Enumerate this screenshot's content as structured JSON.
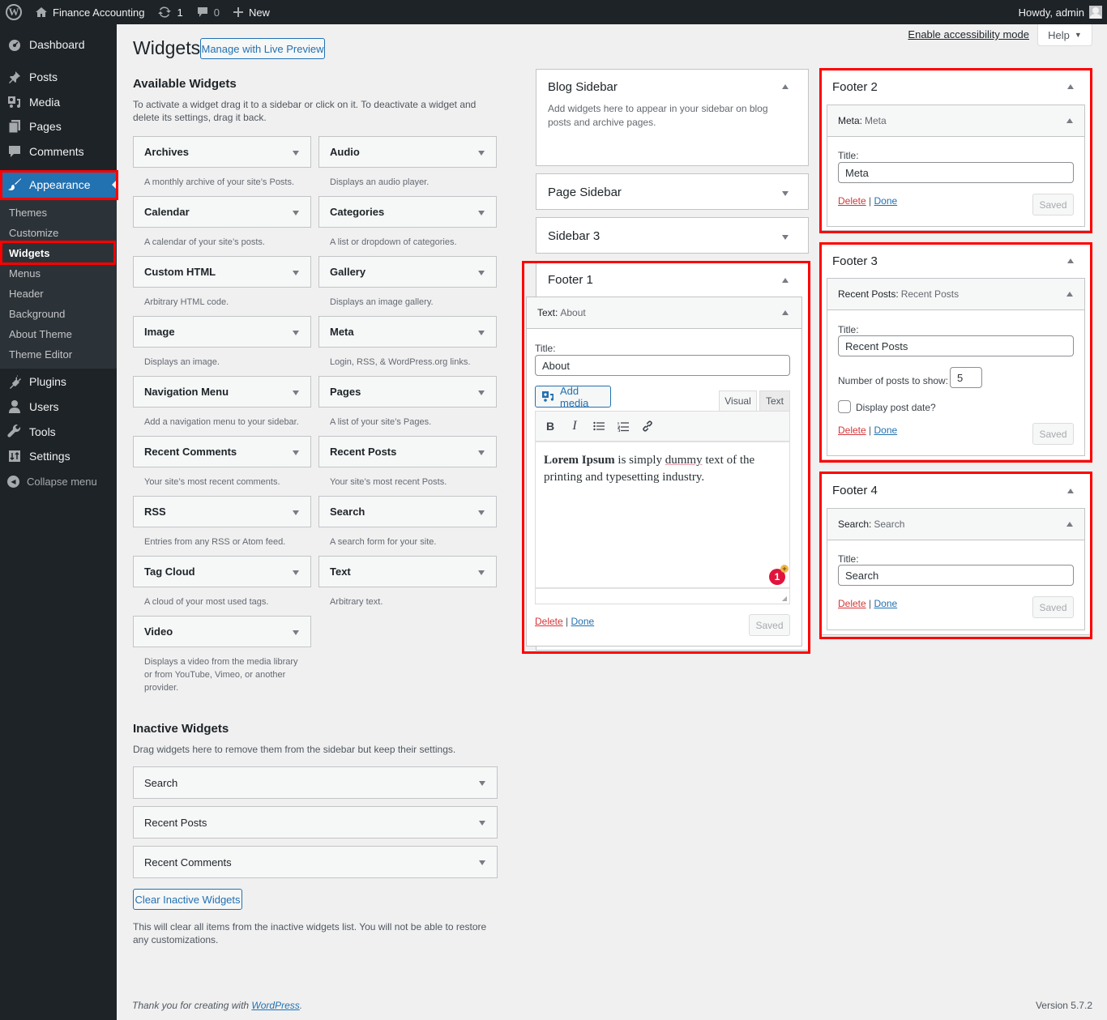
{
  "adminbar": {
    "site_name": "Finance Accounting",
    "updates_count": "1",
    "comments_count": "0",
    "new_label": "New",
    "greeting": "Howdy, admin"
  },
  "menu": {
    "items": [
      {
        "label": "Dashboard",
        "icon": "dashboard-icon"
      },
      {
        "label": "Posts",
        "icon": "pin-icon"
      },
      {
        "label": "Media",
        "icon": "media-icon"
      },
      {
        "label": "Pages",
        "icon": "pages-icon"
      },
      {
        "label": "Comments",
        "icon": "comment-icon"
      },
      {
        "label": "Appearance",
        "icon": "paintbrush-icon"
      },
      {
        "label": "Plugins",
        "icon": "plugin-icon"
      },
      {
        "label": "Users",
        "icon": "user-icon"
      },
      {
        "label": "Tools",
        "icon": "wrench-icon"
      },
      {
        "label": "Settings",
        "icon": "settings-icon"
      }
    ],
    "submenu": [
      "Themes",
      "Customize",
      "Widgets",
      "Menus",
      "Header",
      "Background",
      "About Theme",
      "Theme Editor"
    ],
    "collapse_label": "Collapse menu"
  },
  "header": {
    "title": "Widgets",
    "live_preview_label": "Manage with Live Preview",
    "accessibility_link": "Enable accessibility mode",
    "help_label": "Help"
  },
  "available": {
    "title": "Available Widgets",
    "description": "To activate a widget drag it to a sidebar or click on it. To deactivate a widget and delete its settings, drag it back.",
    "widgets": [
      {
        "name": "Archives",
        "desc": "A monthly archive of your site’s Posts."
      },
      {
        "name": "Audio",
        "desc": "Displays an audio player."
      },
      {
        "name": "Calendar",
        "desc": "A calendar of your site’s posts."
      },
      {
        "name": "Categories",
        "desc": "A list or dropdown of categories."
      },
      {
        "name": "Custom HTML",
        "desc": "Arbitrary HTML code."
      },
      {
        "name": "Gallery",
        "desc": "Displays an image gallery."
      },
      {
        "name": "Image",
        "desc": "Displays an image."
      },
      {
        "name": "Meta",
        "desc": "Login, RSS, & WordPress.org links."
      },
      {
        "name": "Navigation Menu",
        "desc": "Add a navigation menu to your sidebar."
      },
      {
        "name": "Pages",
        "desc": "A list of your site’s Pages."
      },
      {
        "name": "Recent Comments",
        "desc": "Your site’s most recent comments."
      },
      {
        "name": "Recent Posts",
        "desc": "Your site’s most recent Posts."
      },
      {
        "name": "RSS",
        "desc": "Entries from any RSS or Atom feed."
      },
      {
        "name": "Search",
        "desc": "A search form for your site."
      },
      {
        "name": "Tag Cloud",
        "desc": "A cloud of your most used tags."
      },
      {
        "name": "Text",
        "desc": "Arbitrary text."
      },
      {
        "name": "Video",
        "desc": "Displays a video from the media library or from YouTube, Vimeo, or another provider."
      }
    ]
  },
  "inactive": {
    "title": "Inactive Widgets",
    "description": "Drag widgets here to remove them from the sidebar but keep their settings.",
    "widgets": [
      "Search",
      "Recent Posts",
      "Recent Comments"
    ],
    "clear_label": "Clear Inactive Widgets",
    "clear_note": "This will clear all items from the inactive widgets list. You will not be able to restore any customizations."
  },
  "sidebars": {
    "blog": {
      "title": "Blog Sidebar",
      "desc": "Add widgets here to appear in your sidebar on blog posts and archive pages."
    },
    "page": {
      "title": "Page Sidebar"
    },
    "sidebar3": {
      "title": "Sidebar 3"
    },
    "footer1": {
      "title": "Footer 1",
      "widget_type": "Text:",
      "widget_title": "About",
      "title_label": "Title:",
      "title_value": "About",
      "add_media": "Add media",
      "tab_visual": "Visual",
      "tab_text": "Text",
      "content_bold": "Lorem Ipsum",
      "content_pre": " is simply ",
      "content_misspelled": "dummy",
      "content_post": " text of the printing and typesetting industry.",
      "badge_count": "1",
      "delete": "Delete",
      "done": "Done",
      "saved": "Saved"
    },
    "footer2": {
      "title": "Footer 2",
      "widget_type": "Meta:",
      "widget_title": "Meta",
      "title_label": "Title:",
      "title_value": "Meta",
      "delete": "Delete",
      "done": "Done",
      "saved": "Saved"
    },
    "footer3": {
      "title": "Footer 3",
      "widget_type": "Recent Posts:",
      "widget_title": "Recent Posts",
      "title_label": "Title:",
      "title_value": "Recent Posts",
      "number_label": "Number of posts to show:",
      "number_value": "5",
      "date_label": "Display post date?",
      "date_checked": false,
      "delete": "Delete",
      "done": "Done",
      "saved": "Saved"
    },
    "footer4": {
      "title": "Footer 4",
      "widget_type": "Search:",
      "widget_title": "Search",
      "title_label": "Title:",
      "title_value": "Search",
      "delete": "Delete",
      "done": "Done",
      "saved": "Saved"
    }
  },
  "footer": {
    "thanks_pre": "Thank you for creating with ",
    "thanks_link": "WordPress",
    "thanks_post": ".",
    "version": "Version 5.7.2"
  },
  "colors": {
    "accent": "#2271b1",
    "highlight": "#ff0000",
    "menu_bg": "#1d2327",
    "delete": "#d63638"
  }
}
